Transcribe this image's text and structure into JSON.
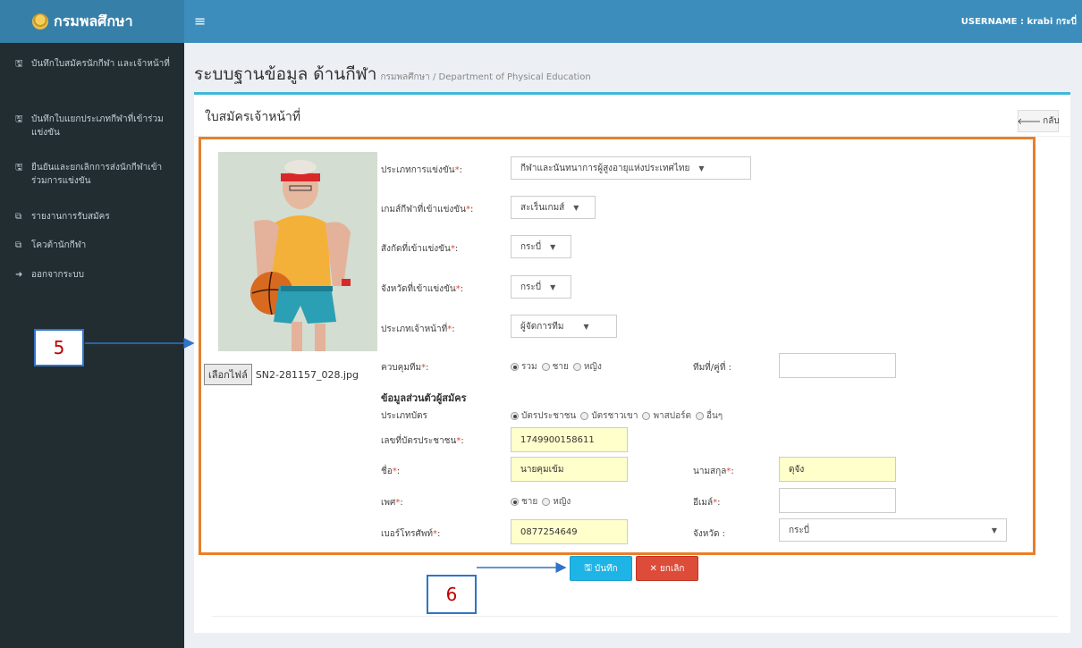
{
  "app": {
    "logo_text": "กรมพลศึกษา",
    "username": "USERNAME : krabi กระบี่",
    "menu_icon": "≡"
  },
  "sidebar": {
    "items": [
      {
        "label": "บันทึกใบสมัครนักกีฬา และเจ้าหน้าที่",
        "icon": "save-icon"
      },
      {
        "label": "บันทึกใบแยกประเภทกีฬาที่เข้าร่วมแข่งขัน",
        "icon": "save-icon"
      },
      {
        "label": "ยืนยันและยกเลิกการส่งนักกีฬาเข้าร่วมการแข่งขัน",
        "icon": "save-icon"
      },
      {
        "label": "รายงานการรับสมัคร",
        "icon": "copy-icon"
      },
      {
        "label": "โควต้านักกีฬา",
        "icon": "copy-icon"
      },
      {
        "label": "ออกจากระบบ",
        "icon": "sign-out-icon"
      }
    ]
  },
  "header": {
    "title": "ระบบฐานข้อมูล ด้านกีฬา",
    "subtitle": "กรมพลศึกษา / Department of Physical Education"
  },
  "box": {
    "title": "ใบสมัครเจ้าหน้าที่",
    "back_label": "กลับ"
  },
  "photo": {
    "file_button": "เลือกไฟล์",
    "file_name": "SN2-281157_028.jpg"
  },
  "form": {
    "competition_type": {
      "label": "ประเภทการแข่งขัน",
      "value": "กีฬาและนันทนาการผู้สูงอายุแห่งประเทศไทย"
    },
    "game": {
      "label": "เกมส์กีฬาที่เข้าแข่งขัน",
      "value": "สะเร็นเกมส์"
    },
    "affiliation": {
      "label": "สังกัดที่เข้าแข่งขัน",
      "value": "กระบี่"
    },
    "province_compete": {
      "label": "จังหวัดที่เข้าแข่งขัน",
      "value": "กระบี่"
    },
    "official_type": {
      "label": "ประเภทเจ้าหน้าที่",
      "value": "ผู้จัดการทีม"
    },
    "team_control": {
      "label": "ควบคุมทีม",
      "options": [
        "รวม",
        "ชาย",
        "หญิง"
      ],
      "selected": "รวม"
    },
    "team_no": {
      "label": "ทีมที่/คู่ที่ :",
      "value": ""
    },
    "personal_heading": "ข้อมูลส่วนตัวผู้สมัคร",
    "card_type": {
      "label": "ประเภทบัตร",
      "options": [
        "บัตรประชาชน",
        "บัตรชาวเขา",
        "พาสปอร์ต",
        "อื่นๆ"
      ],
      "selected": "บัตรประชาชน"
    },
    "id_number": {
      "label": "เลขที่บัตรประชาชน",
      "value": "1749900158611"
    },
    "first_name": {
      "label": "ชื่อ",
      "value": "นายคุมเข้ม"
    },
    "last_name": {
      "label": "นามสกุล",
      "value": "ดุจัง"
    },
    "gender": {
      "label": "เพศ",
      "options": [
        "ชาย",
        "หญิง"
      ],
      "selected": "ชาย"
    },
    "email": {
      "label": "อีเมล์",
      "value": ""
    },
    "phone": {
      "label": "เบอร์โทรศัพท์",
      "value": "0877254649"
    },
    "province": {
      "label": "จังหวัด :",
      "value": "กระบี่"
    }
  },
  "actions": {
    "save_label": "บันทึก",
    "cancel_label": "ยกเลิก"
  },
  "callouts": {
    "five": "5",
    "six": "6"
  },
  "colors": {
    "topbar": "#3c8dbc",
    "sidebar": "#222d32",
    "accent_frame": "#e97f2a",
    "save": "#1fb4e6",
    "cancel": "#dd4b39",
    "callout_border": "#2e74c8"
  }
}
